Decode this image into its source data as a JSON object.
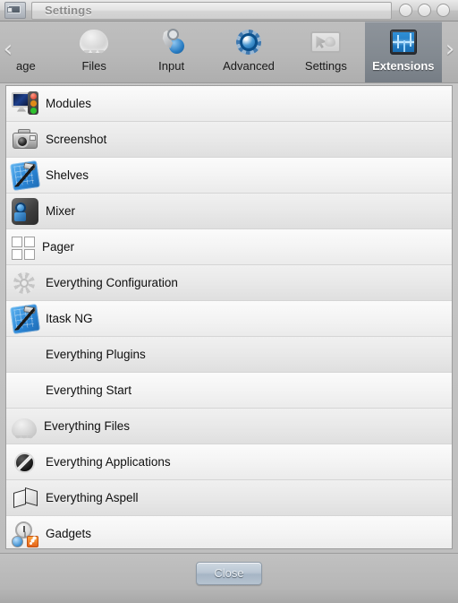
{
  "window": {
    "title": "Settings",
    "titlebar_icon": "window-settings-icon",
    "controls": [
      {
        "name": "minimize-button",
        "label": ""
      },
      {
        "name": "maximize-button",
        "label": ""
      },
      {
        "name": "close-window-button",
        "label": ""
      }
    ]
  },
  "toolbar": {
    "prev_arrow": "‹",
    "next_arrow": "›",
    "tabs": [
      {
        "label": "age",
        "icon": "language-icon",
        "selected": false,
        "partial": true
      },
      {
        "label": "Files",
        "icon": "files-icon",
        "selected": false
      },
      {
        "label": "Input",
        "icon": "input-keys-icon",
        "selected": false
      },
      {
        "label": "Advanced",
        "icon": "blue-gear-icon",
        "selected": false
      },
      {
        "label": "Settings",
        "icon": "settings-screen-icon",
        "selected": false
      },
      {
        "label": "Extensions",
        "icon": "extensions-board-icon",
        "selected": true
      }
    ]
  },
  "list": {
    "items": [
      {
        "label": "Modules",
        "icon": "modules-monitor-icon"
      },
      {
        "label": "Screenshot",
        "icon": "camera-icon"
      },
      {
        "label": "Shelves",
        "icon": "blueprint-hammer-icon"
      },
      {
        "label": "Mixer",
        "icon": "mixer-icon"
      },
      {
        "label": "Pager",
        "icon": "pager-grid-icon"
      },
      {
        "label": "Everything Configuration",
        "icon": "grey-gear-icon"
      },
      {
        "label": "Itask NG",
        "icon": "blueprint-hammer-icon"
      },
      {
        "label": "Everything Plugins",
        "icon": ""
      },
      {
        "label": "Everything Start",
        "icon": ""
      },
      {
        "label": "Everything Files",
        "icon": "grey-blob-icon"
      },
      {
        "label": "Everything Applications",
        "icon": "applications-icon"
      },
      {
        "label": "Everything Aspell",
        "icon": "open-book-icon"
      },
      {
        "label": "Gadgets",
        "icon": "gadgets-clock-rss-icon"
      }
    ]
  },
  "footer": {
    "close_label": "Close"
  },
  "colors": {
    "selected_tab": "#828990",
    "window_bg": "#bdbdbd",
    "list_row": "#f4f4f4",
    "list_row_alt": "#e9e9e9",
    "accent_blue": "#2a7ec4"
  }
}
